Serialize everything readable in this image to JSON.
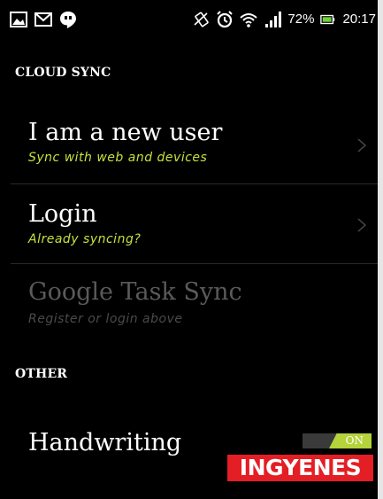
{
  "status_bar": {
    "left_icons": [
      "gallery-icon",
      "gmail-icon",
      "hangouts-icon"
    ],
    "right_icons": [
      "vibrate-icon",
      "alarm-icon",
      "wifi-icon",
      "signal-icon",
      "battery-icon"
    ],
    "battery_percent": "72%",
    "time": "20:17"
  },
  "sections": {
    "cloud_sync": "CLOUD SYNC",
    "other": "OTHER"
  },
  "items": {
    "new_user": {
      "title": "I am a new user",
      "subtitle": "Sync with web and devices"
    },
    "login": {
      "title": "Login",
      "subtitle": "Already syncing?"
    },
    "google_task_sync": {
      "title": "Google Task Sync",
      "subtitle": "Register or login above"
    },
    "handwriting": {
      "title": "Handwriting",
      "toggle_state": "ON"
    }
  },
  "watermark": {
    "text": "INGYENES"
  },
  "colors": {
    "accent_green": "#c5e13c",
    "toggle_on": "#b5d33a",
    "watermark_red": "#e31e24"
  }
}
